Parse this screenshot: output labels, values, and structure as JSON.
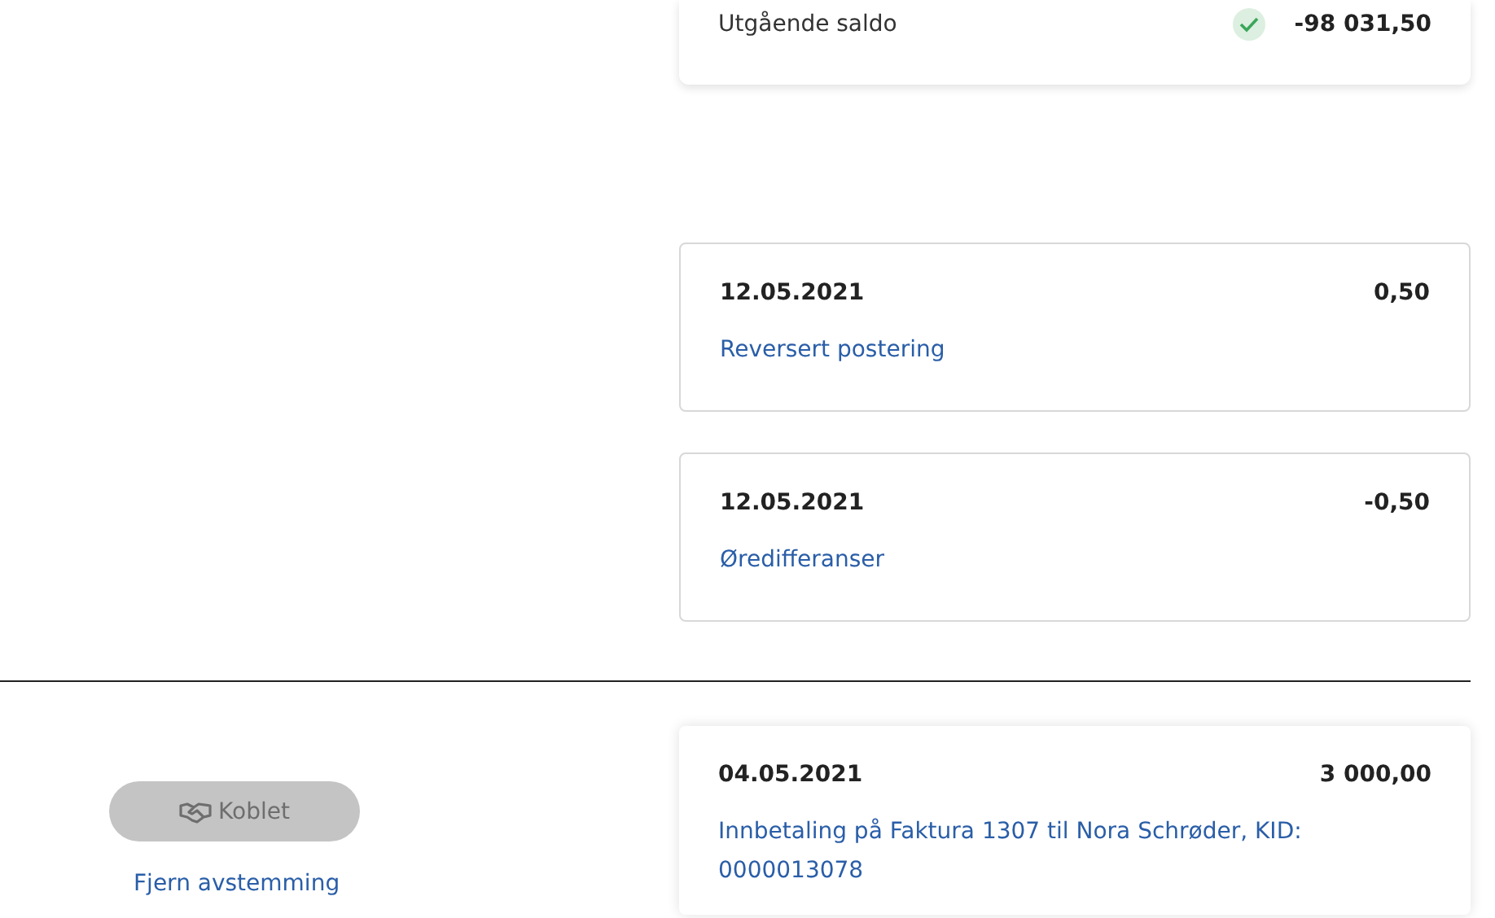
{
  "closing_balance": {
    "label": "Utgående saldo",
    "verified": true,
    "amount": "-98 031,50"
  },
  "entries": [
    {
      "date": "12.05.2021",
      "amount": "0,50",
      "description": "Reversert postering"
    },
    {
      "date": "12.05.2021",
      "amount": "-0,50",
      "description": "Øredifferanser"
    }
  ],
  "match": {
    "button": {
      "label": "Koblet",
      "disabled": true
    },
    "link": "Fjern avstemming",
    "entry": {
      "date": "04.05.2021",
      "amount": "3 000,00",
      "description": "Innbetaling på Faktura 1307 til Nora Schrøder, KID: 0000013078"
    }
  }
}
